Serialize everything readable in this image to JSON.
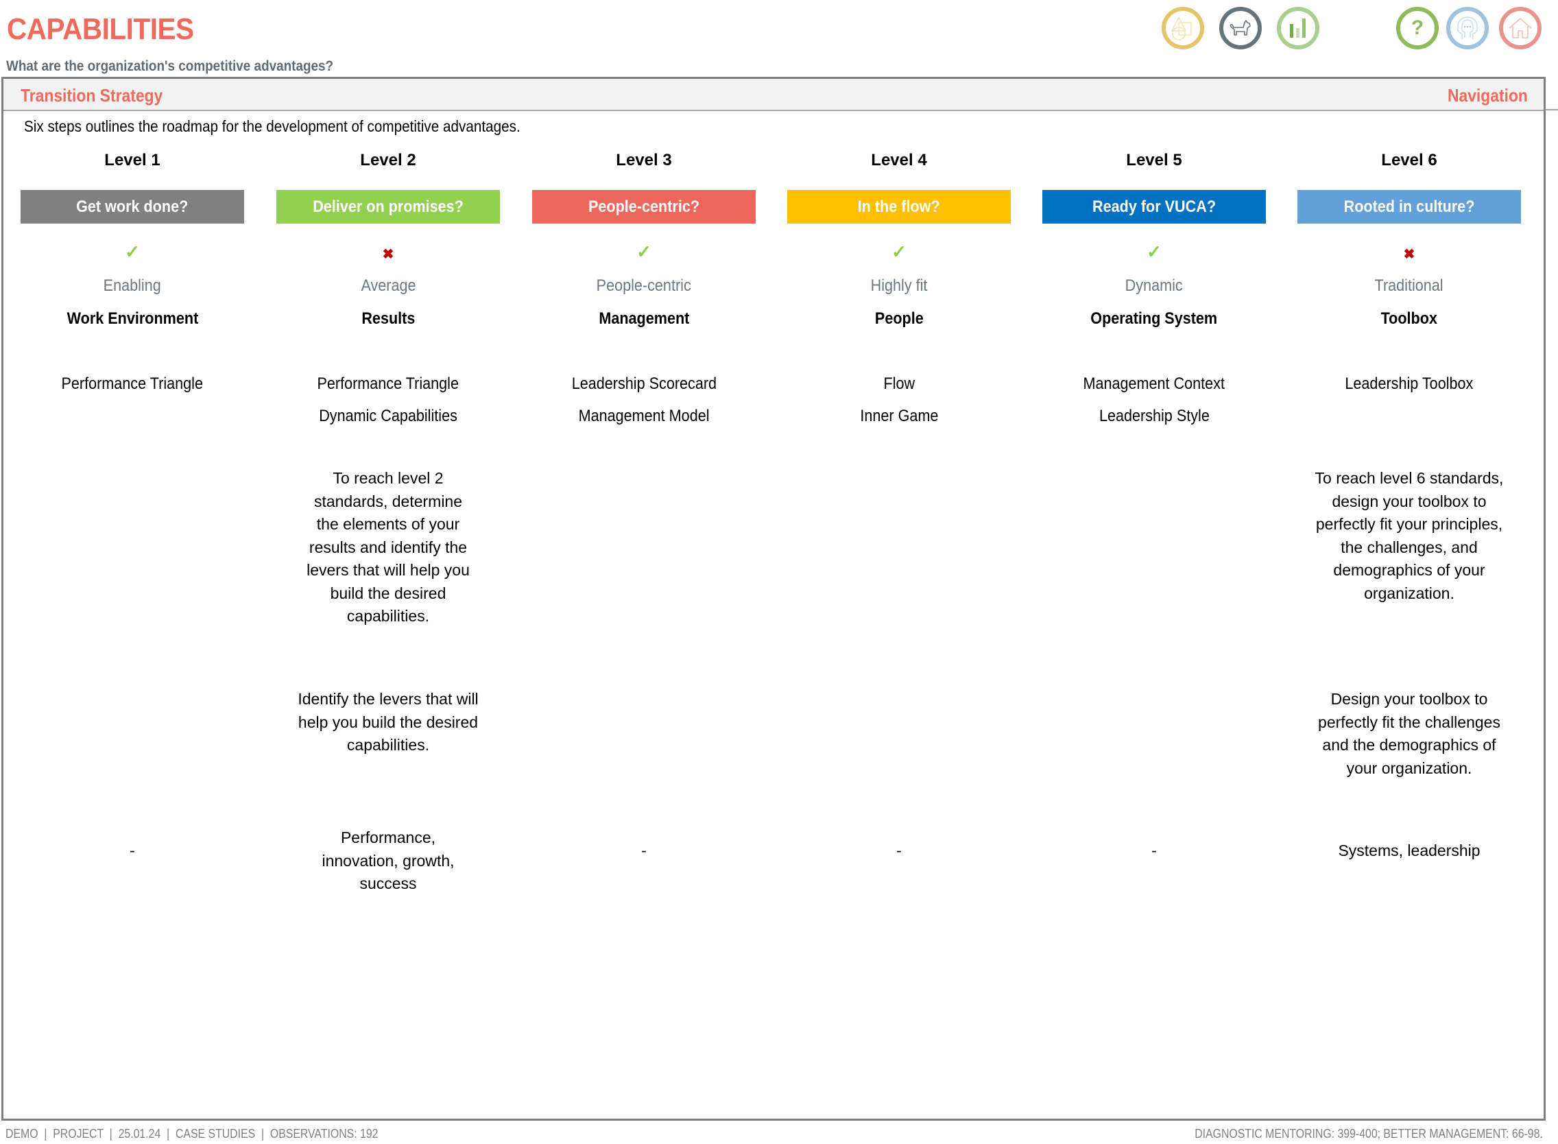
{
  "page": {
    "title": "CAPABILITIES",
    "subtitle": "What are the organization's competitive advantages?"
  },
  "toolbar": {
    "icons": [
      {
        "name": "shapes-icon",
        "color": "#e6c46a"
      },
      {
        "name": "dog-icon",
        "color": "#66737b"
      },
      {
        "name": "bar-chart-icon",
        "color": "#a9d08e"
      },
      {
        "name": "help-icon",
        "color": "#8fbc5a",
        "glyph": "?"
      },
      {
        "name": "people-icon",
        "color": "#9dc3e0"
      },
      {
        "name": "home-icon",
        "color": "#e8948c"
      }
    ]
  },
  "section": {
    "title": "Transition Strategy",
    "navigation_label": "Navigation",
    "intro": "Six steps outlines the roadmap for the development of competitive advantages."
  },
  "levels": [
    {
      "label": "Level 1",
      "question": "Get work done?",
      "color": "#808080",
      "achieved": true,
      "mark": "✓",
      "status": "Enabling",
      "title": "Work Environment",
      "tools": [
        "Performance Triangle",
        ""
      ],
      "description": "",
      "hint": "",
      "outcome": "-"
    },
    {
      "label": "Level 2",
      "question": "Deliver on promises?",
      "color": "#92d050",
      "achieved": false,
      "mark": "✖",
      "status": "Average",
      "title": "Results",
      "tools": [
        "Performance Triangle",
        "Dynamic Capabilities"
      ],
      "description": "To reach level 2 standards, determine the elements of your results and identify the levers that will help you build the desired capabilities.",
      "hint": "Identify the levers that will help you build the desired capabilities.",
      "outcome": "Performance, innovation, growth, success"
    },
    {
      "label": "Level 3",
      "question": "People-centric?",
      "color": "#ec665c",
      "achieved": true,
      "mark": "✓",
      "status": "People-centric",
      "title": "Management",
      "tools": [
        "Leadership Scorecard",
        "Management Model"
      ],
      "description": "",
      "hint": "",
      "outcome": "-"
    },
    {
      "label": "Level 4",
      "question": "In the flow?",
      "color": "#ffc000",
      "achieved": true,
      "mark": "✓",
      "status": "Highly fit",
      "title": "People",
      "tools": [
        "Flow",
        "Inner Game"
      ],
      "description": "",
      "hint": "",
      "outcome": "-"
    },
    {
      "label": "Level 5",
      "question": "Ready for VUCA?",
      "color": "#0070c0",
      "achieved": true,
      "mark": "✓",
      "status": "Dynamic",
      "title": "Operating System",
      "tools": [
        "Management Context",
        "Leadership Style"
      ],
      "description": "",
      "hint": "",
      "outcome": "-"
    },
    {
      "label": "Level 6",
      "question": "Rooted in culture?",
      "color": "#62a0d8",
      "achieved": false,
      "mark": "✖",
      "status": "Traditional",
      "title": "Toolbox",
      "tools": [
        "Leadership Toolbox",
        ""
      ],
      "description": "To reach level 6 standards, design your toolbox to perfectly fit your principles, the challenges, and demographics of your organization.",
      "hint": "Design your toolbox to perfectly fit the challenges and the demographics of your organization.",
      "outcome": "Systems, leadership"
    }
  ],
  "footer": {
    "left": "DEMO  |  PROJECT  |  25.01.24  |  CASE STUDIES  |  OBSERVATIONS: 192",
    "right": "DIAGNOSTIC MENTORING: 399-400; BETTER MANAGEMENT: 66-98."
  }
}
